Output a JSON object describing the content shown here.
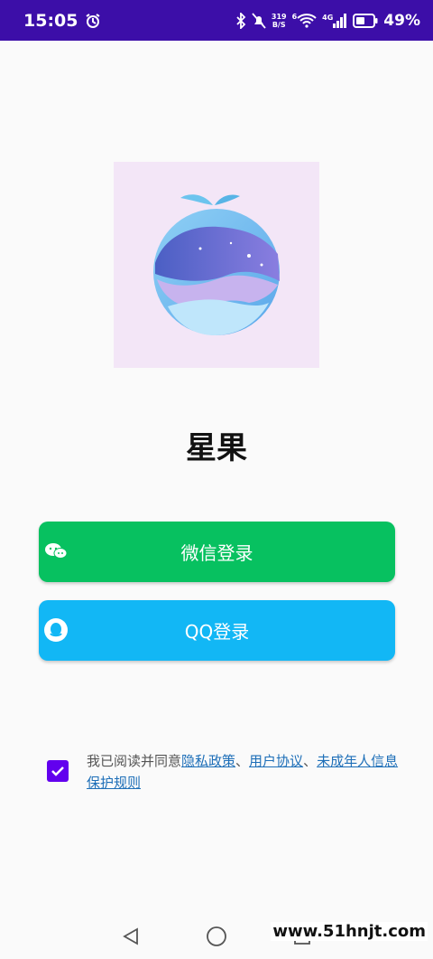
{
  "status_bar": {
    "time": "15:05",
    "net_speed_value": "319",
    "net_speed_unit": "B/S",
    "wifi_label": "6",
    "cell_label": "4G",
    "battery_percent": "49%"
  },
  "app": {
    "name": "星果"
  },
  "buttons": {
    "wechat_label": "微信登录",
    "qq_label": "QQ登录"
  },
  "agreement": {
    "checked": true,
    "prefix": "我已阅读并同意",
    "privacy_link": "隐私政策",
    "sep1": "、",
    "user_link": "用户协议",
    "sep2": "、",
    "minor_link": "未成年人信息保护规则"
  },
  "watermark": "www.51hnjt.com",
  "colors": {
    "status_bar": "#3c0ea8",
    "wechat": "#07c160",
    "qq": "#12b7f5",
    "checkbox": "#6200ee",
    "link": "#1e6fb8"
  }
}
